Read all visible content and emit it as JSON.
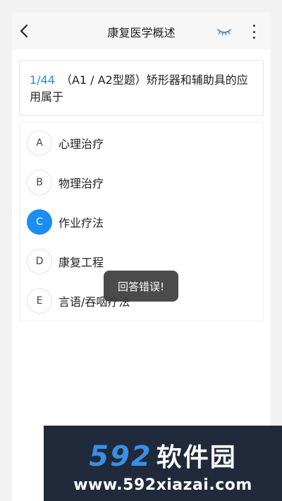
{
  "header": {
    "title": "康复医学概述",
    "back_icon": "chevron-left-icon",
    "eye_icon": "eye-closed-icon",
    "more_icon": "more-vertical-icon"
  },
  "question": {
    "index": "1/44",
    "text": "（A1 / A2型题）矫形器和辅助具的应用属于"
  },
  "options": [
    {
      "letter": "A",
      "text": "心理治疗",
      "selected": false
    },
    {
      "letter": "B",
      "text": "物理治疗",
      "selected": false
    },
    {
      "letter": "C",
      "text": "作业疗法",
      "selected": true
    },
    {
      "letter": "D",
      "text": "康复工程",
      "selected": false
    },
    {
      "letter": "E",
      "text": "言语/吞咽疗法",
      "selected": false
    }
  ],
  "toast": {
    "message": "回答错误!"
  },
  "watermark": {
    "number": "592",
    "cn": "软件园",
    "url": "www.592xiazai.com"
  },
  "colors": {
    "accent": "#1c8ef0",
    "index_blue": "#2a8ad8",
    "header_bg": "#f7f7f7",
    "watermark_bg": "#202a3b"
  }
}
